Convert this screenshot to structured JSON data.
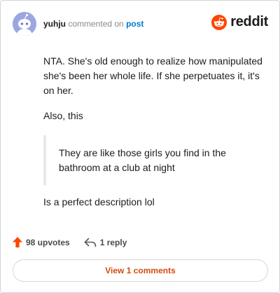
{
  "header": {
    "username": "yuhju",
    "action_text": "commented on",
    "post_link": "post"
  },
  "logo": {
    "wordmark": "reddit",
    "icon": "reddit-snoo-icon",
    "brand_color": "#ff4500"
  },
  "comment": {
    "paragraph1": "NTA. She's old enough to realize how manipulated she's been her whole life. If she perpetuates it, it's on her.",
    "paragraph2": "Also, this",
    "quote": "They are like those girls you find in the bathroom at a club at night",
    "paragraph3": "Is a perfect description lol"
  },
  "footer": {
    "upvotes_label": "98 upvotes",
    "upvote_icon": "upvote-arrow-icon",
    "upvote_color": "#ff4500",
    "replies_label": "1 reply",
    "reply_icon": "reply-arrow-icon"
  },
  "view_button": {
    "label": "View 1 comments",
    "color": "#d34a10"
  }
}
